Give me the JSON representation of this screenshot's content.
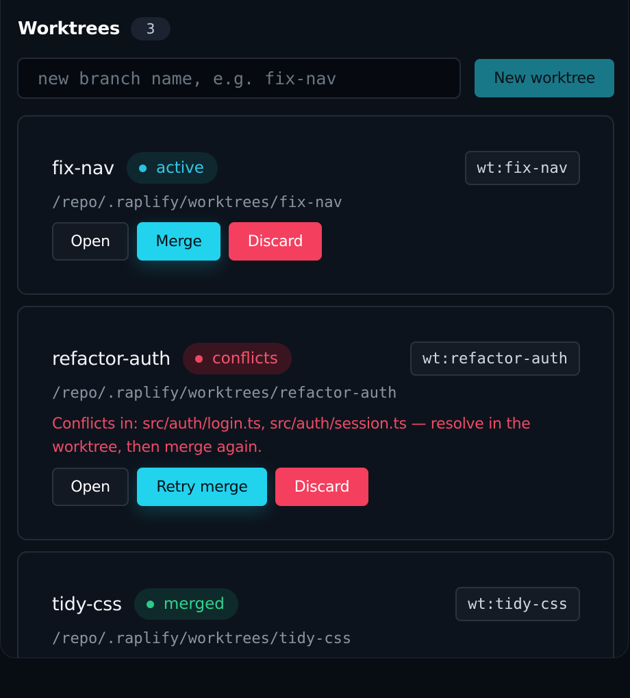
{
  "header": {
    "title": "Worktrees",
    "count": "3"
  },
  "create": {
    "placeholder": "new branch name, e.g. fix-nav",
    "value": "",
    "button_label": "New worktree"
  },
  "worktrees": [
    {
      "name": "fix-nav",
      "status": "active",
      "tag": "wt:fix-nav",
      "path": "/repo/.raplify/worktrees/fix-nav",
      "message": "",
      "actions": {
        "open": "Open",
        "merge": "Merge",
        "discard": "Discard"
      }
    },
    {
      "name": "refactor-auth",
      "status": "conflicts",
      "tag": "wt:refactor-auth",
      "path": "/repo/.raplify/worktrees/refactor-auth",
      "message": "Conflicts in: src/auth/login.ts, src/auth/session.ts — resolve in the worktree, then merge again.",
      "actions": {
        "open": "Open",
        "merge": "Retry merge",
        "discard": "Discard"
      }
    },
    {
      "name": "tidy-css",
      "status": "merged",
      "tag": "wt:tidy-css",
      "path": "/repo/.raplify/worktrees/tidy-css",
      "message": "",
      "actions": {}
    }
  ],
  "colors": {
    "accent": "#22d3ee",
    "danger": "#f43f5e",
    "success": "#2bcb88",
    "primary_button": "#197888"
  }
}
